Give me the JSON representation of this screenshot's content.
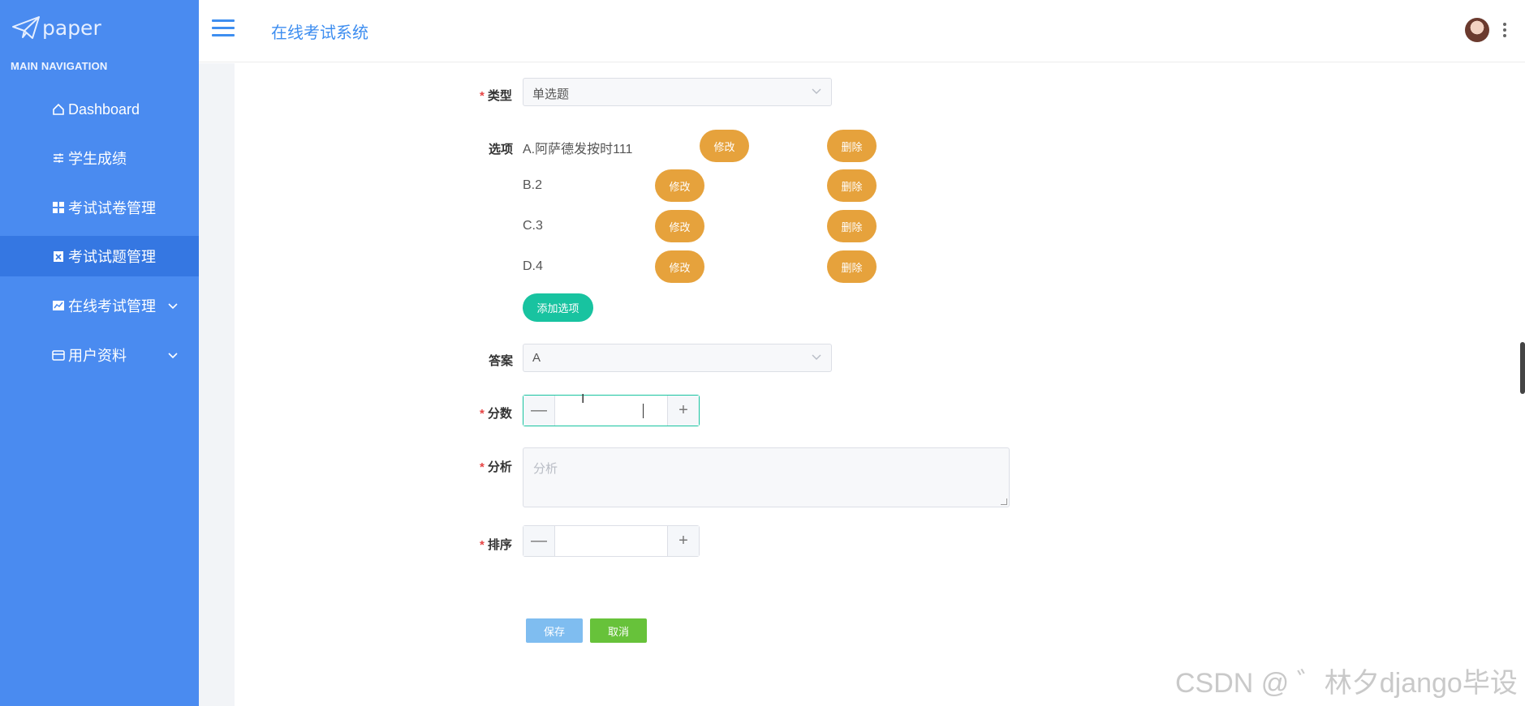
{
  "brand": {
    "logo_text": "paper"
  },
  "sidebar": {
    "heading": "MAIN NAVIGATION",
    "items": [
      {
        "label": "Dashboard",
        "icon": "home-icon"
      },
      {
        "label": "学生成绩",
        "icon": "sliders-icon"
      },
      {
        "label": "考试试卷管理",
        "icon": "grid-icon"
      },
      {
        "label": "考试试题管理",
        "icon": "clipboard-icon",
        "active": true
      },
      {
        "label": "在线考试管理",
        "icon": "chart-icon",
        "expandable": true
      },
      {
        "label": "用户资料",
        "icon": "card-icon",
        "expandable": true
      }
    ]
  },
  "header": {
    "title": "在线考试系统"
  },
  "form": {
    "type_label": "类型",
    "type_value": "单选题",
    "options_label": "选项",
    "options": [
      {
        "text": "A.阿萨德发按时111",
        "edit_label": "修改",
        "delete_label": "删除"
      },
      {
        "text": "B.2",
        "edit_label": "修改",
        "delete_label": "删除"
      },
      {
        "text": "C.3",
        "edit_label": "修改",
        "delete_label": "删除"
      },
      {
        "text": "D.4",
        "edit_label": "修改",
        "delete_label": "删除"
      }
    ],
    "add_option_label": "添加选项",
    "answer_label": "答案",
    "answer_value": "A",
    "score_label": "分数",
    "analysis_label": "分析",
    "analysis_placeholder": "分析",
    "order_label": "排序",
    "minus_symbol": "—",
    "plus_symbol": "+",
    "save_label": "保存",
    "cancel_label": "取消"
  },
  "watermark": "CSDN @ ゛林夕django毕设",
  "colors": {
    "sidebar": "#4a8bf0",
    "accent": "#3e8ef0",
    "warning": "#e6a23c",
    "success": "#18c3a0"
  }
}
